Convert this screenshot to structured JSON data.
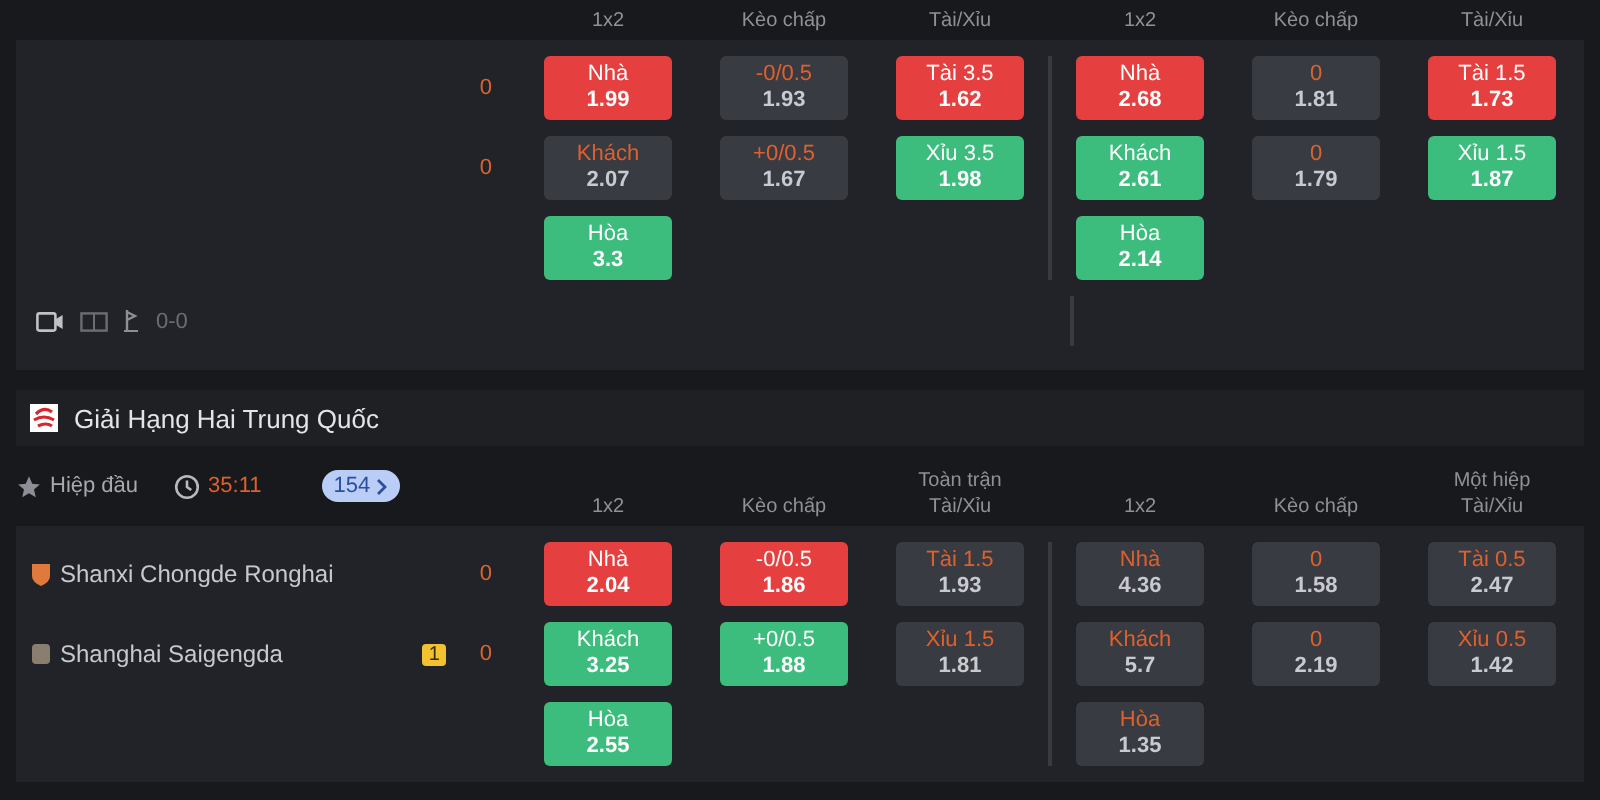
{
  "matches": [
    {
      "headings": [
        {
          "label": "1x2"
        },
        {
          "label": "Kèo chấp"
        },
        {
          "label": "Tài/Xỉu"
        },
        {
          "label": "1x2"
        },
        {
          "label": "Kèo chấp"
        },
        {
          "label": "Tài/Xỉu"
        }
      ],
      "teams": [
        {
          "score": "0"
        },
        {
          "score": "0"
        }
      ],
      "markets": [
        [
          [
            {
              "label": "Nhà",
              "value": "1.99",
              "kind": "red"
            },
            {
              "label": "Khách",
              "value": "2.07",
              "kind": "grey"
            },
            {
              "label": "Hòa",
              "value": "3.3",
              "kind": "green"
            }
          ],
          [
            {
              "label": "-0/0.5",
              "value": "1.93",
              "kind": "grey"
            },
            {
              "label": "+0/0.5",
              "value": "1.67",
              "kind": "grey"
            }
          ],
          [
            {
              "label": "Tài 3.5",
              "value": "1.62",
              "kind": "red"
            },
            {
              "label": "Xỉu 3.5",
              "value": "1.98",
              "kind": "green"
            }
          ]
        ],
        [
          [
            {
              "label": "Nhà",
              "value": "2.68",
              "kind": "red"
            },
            {
              "label": "Khách",
              "value": "2.61",
              "kind": "green"
            },
            {
              "label": "Hòa",
              "value": "2.14",
              "kind": "green"
            }
          ],
          [
            {
              "label": "0",
              "value": "1.81",
              "kind": "grey"
            },
            {
              "label": "0",
              "value": "1.79",
              "kind": "grey"
            }
          ],
          [
            {
              "label": "Tài 1.5",
              "value": "1.73",
              "kind": "red"
            },
            {
              "label": "Xỉu 1.5",
              "value": "1.87",
              "kind": "green"
            }
          ]
        ]
      ],
      "footer": {
        "score": "0-0"
      }
    },
    {
      "league": "Giải Hạng Hai Trung Quốc",
      "period": "Hiệp đầu",
      "clock": "35:11",
      "count": "154",
      "headings": [
        {
          "label": "1x2"
        },
        {
          "label": "Kèo chấp"
        },
        {
          "top": "Toàn trận",
          "label": "Tài/Xỉu"
        },
        {
          "label": "1x2"
        },
        {
          "label": "Kèo chấp"
        },
        {
          "top": "Một hiệp",
          "label": "Tài/Xỉu"
        }
      ],
      "teams": [
        {
          "name": "Shanxi Chongde Ronghai",
          "score": "0"
        },
        {
          "name": "Shanghai Saigengda",
          "card": "1",
          "score": "0"
        }
      ],
      "markets": [
        [
          [
            {
              "label": "Nhà",
              "value": "2.04",
              "kind": "red"
            },
            {
              "label": "Khách",
              "value": "3.25",
              "kind": "green"
            },
            {
              "label": "Hòa",
              "value": "2.55",
              "kind": "green"
            }
          ],
          [
            {
              "label": "-0/0.5",
              "value": "1.86",
              "kind": "red"
            },
            {
              "label": "+0/0.5",
              "value": "1.88",
              "kind": "green"
            }
          ],
          [
            {
              "label": "Tài 1.5",
              "value": "1.93",
              "kind": "grey"
            },
            {
              "label": "Xỉu 1.5",
              "value": "1.81",
              "kind": "grey"
            }
          ]
        ],
        [
          [
            {
              "label": "Nhà",
              "value": "4.36",
              "kind": "grey"
            },
            {
              "label": "Khách",
              "value": "5.7",
              "kind": "grey"
            },
            {
              "label": "Hòa",
              "value": "1.35",
              "kind": "grey"
            }
          ],
          [
            {
              "label": "0",
              "value": "1.58",
              "kind": "grey"
            },
            {
              "label": "0",
              "value": "2.19",
              "kind": "grey"
            }
          ],
          [
            {
              "label": "Tài 0.5",
              "value": "2.47",
              "kind": "grey"
            },
            {
              "label": "Xỉu 0.5",
              "value": "1.42",
              "kind": "grey"
            }
          ]
        ]
      ]
    }
  ]
}
